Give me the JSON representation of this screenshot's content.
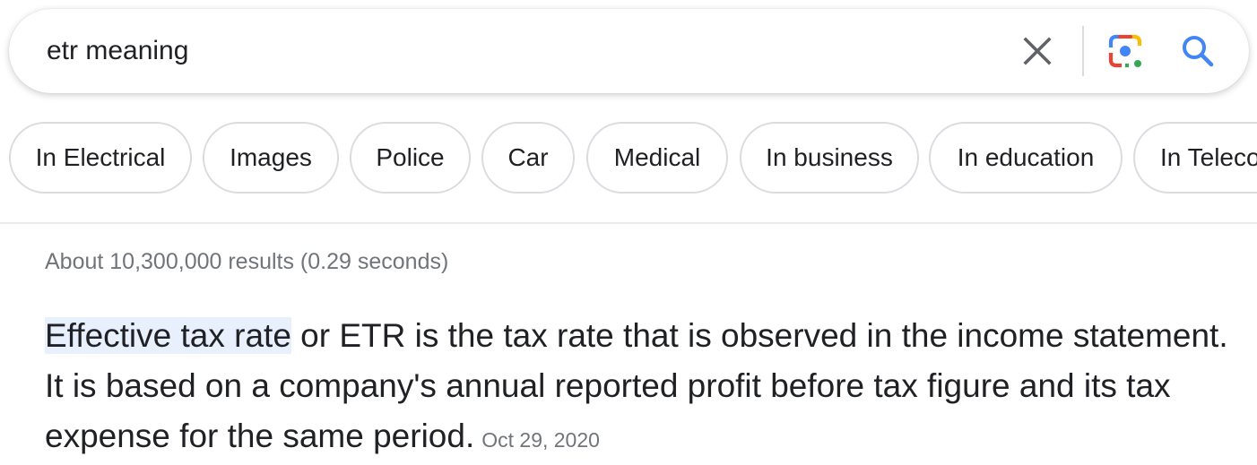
{
  "search": {
    "query": "etr meaning",
    "clear_icon": "close-icon",
    "lens_icon": "google-lens-icon",
    "search_icon": "search-icon"
  },
  "chips": [
    {
      "label": "In Electrical"
    },
    {
      "label": "Images"
    },
    {
      "label": "Police"
    },
    {
      "label": "Car"
    },
    {
      "label": "Medical"
    },
    {
      "label": "In business"
    },
    {
      "label": "In education"
    },
    {
      "label": "In Telecom"
    }
  ],
  "results": {
    "stats": "About 10,300,000 results (0.29 seconds)"
  },
  "snippet": {
    "highlight": "Effective tax rate",
    "text": " or ETR is the tax rate that is observed in the income statement. It is based on a company's annual reported profit before tax figure and its tax expense for the same period.",
    "date": "Oct 29, 2020"
  },
  "colors": {
    "lens_blue": "#4285f4",
    "lens_red": "#ea4335",
    "lens_yellow": "#fbbc04",
    "lens_green": "#34a853",
    "search_blue": "#4285f4",
    "highlight_bg": "#e8f0fe"
  }
}
